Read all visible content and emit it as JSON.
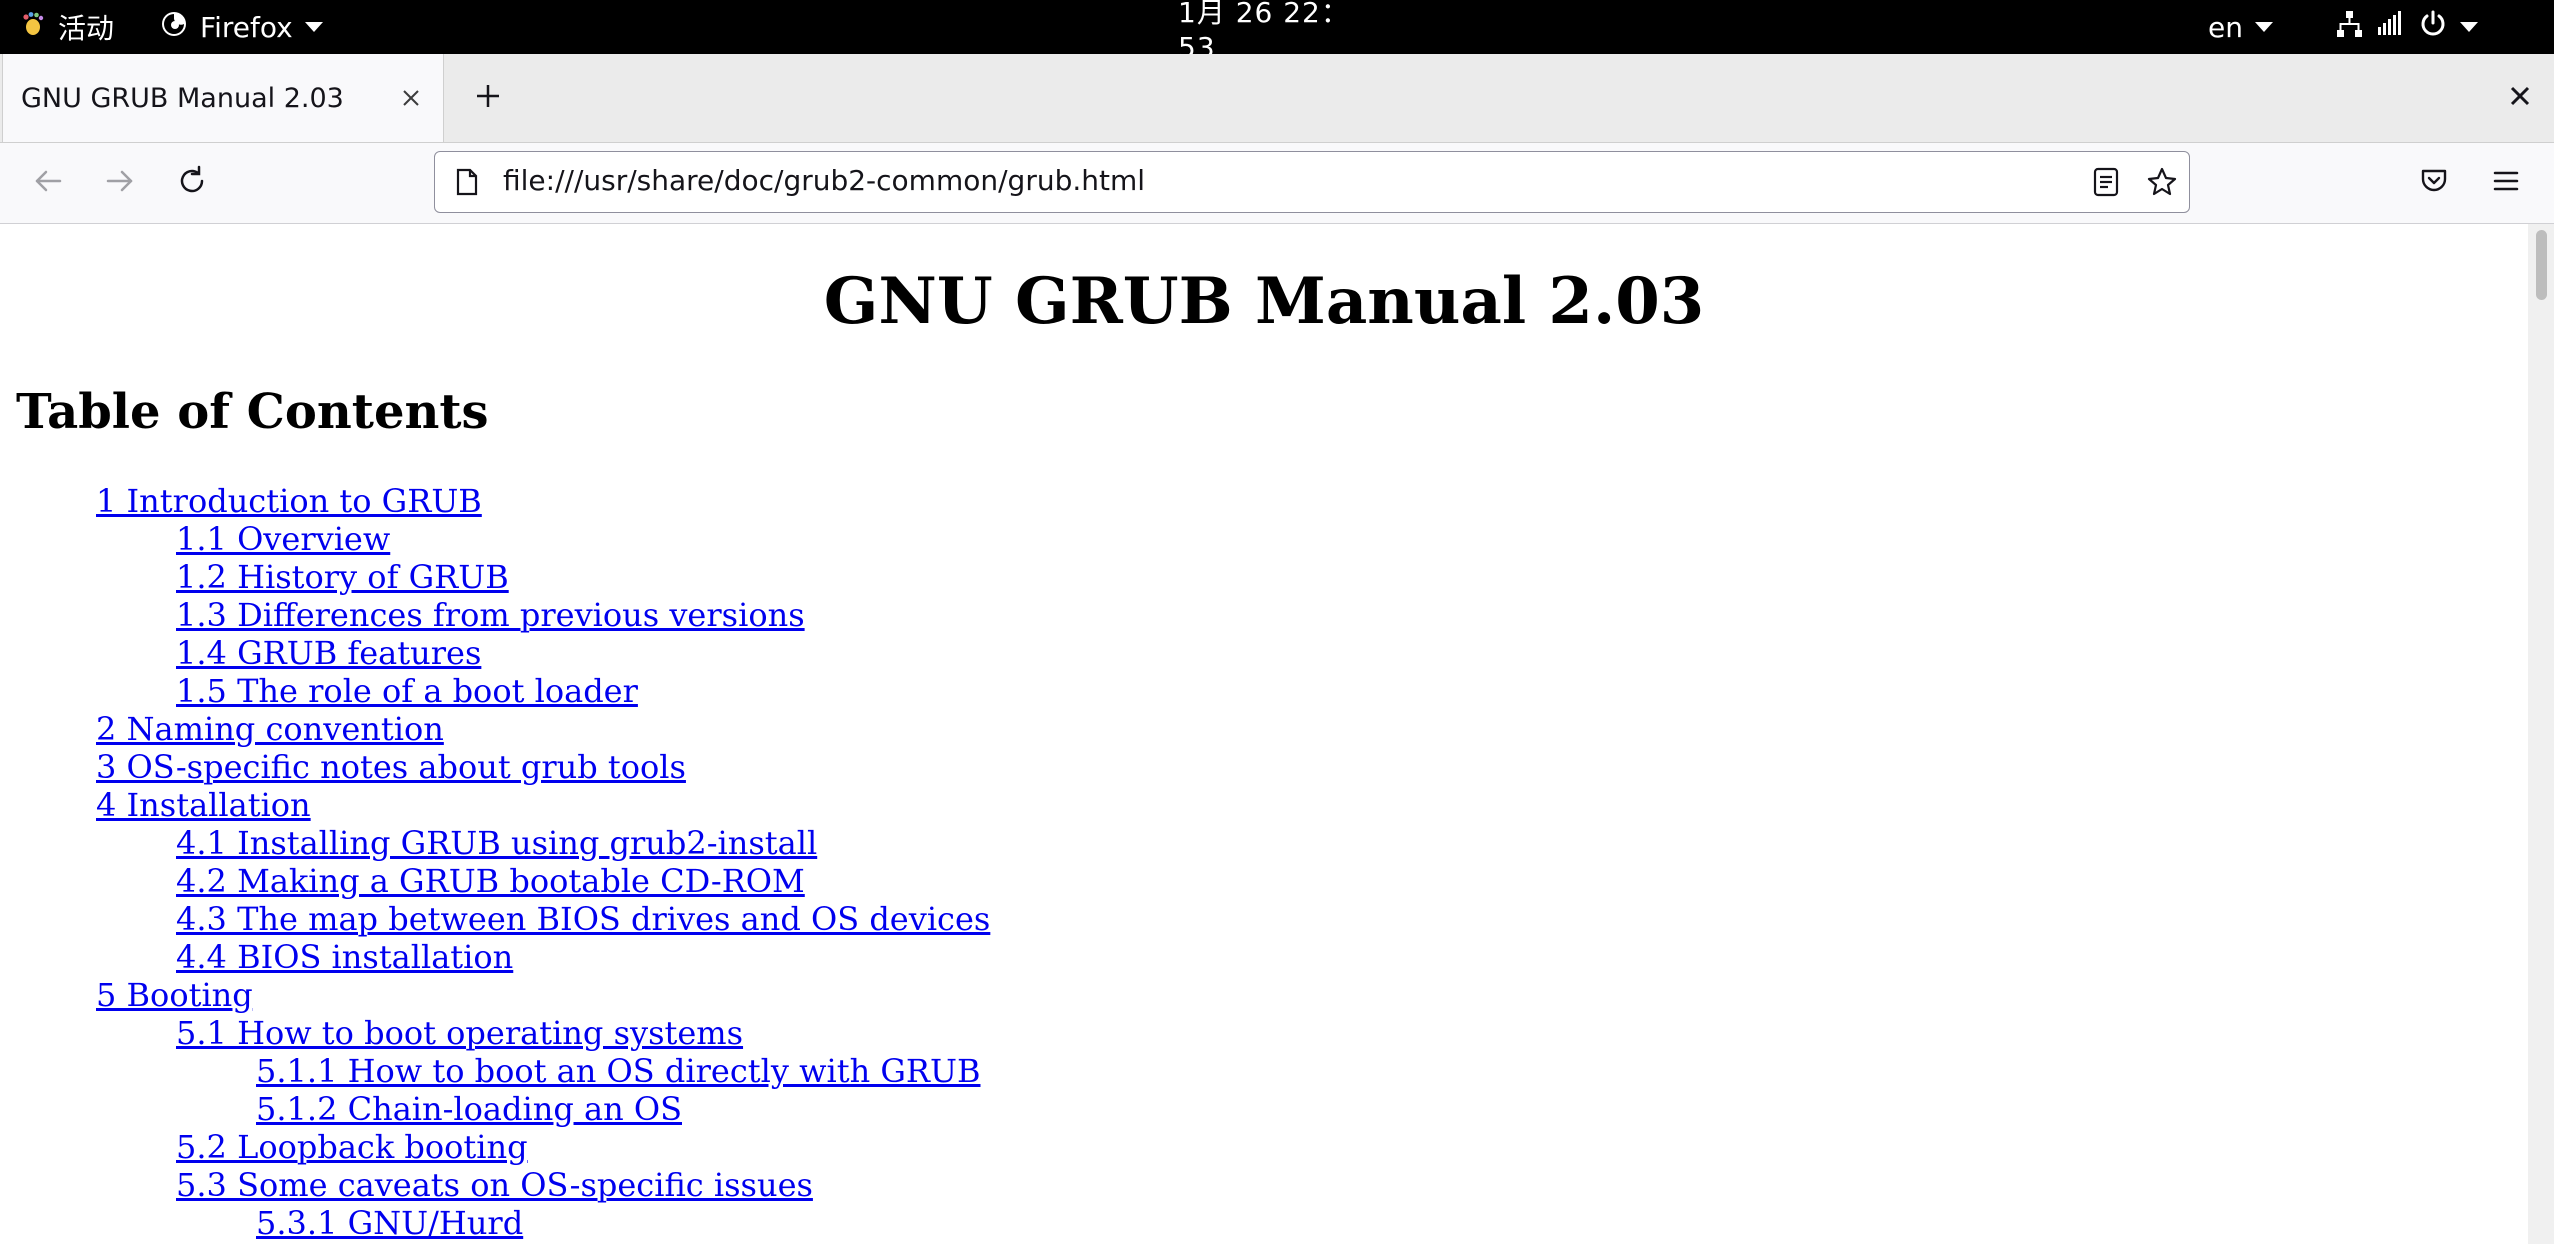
{
  "os_topbar": {
    "activities_label": "活动",
    "app_label": "Firefox",
    "clock": "1月 26  22：53",
    "input_lang": "en",
    "icons": [
      "network-icon",
      "volume-icon",
      "power-icon"
    ]
  },
  "browser": {
    "tab": {
      "title": "GNU GRUB Manual 2.03"
    },
    "url": "file:///usr/share/doc/grub2-common/grub.html",
    "icons": {
      "back": "back-arrow-icon",
      "forward": "forward-arrow-icon",
      "reload": "reload-icon",
      "page": "page-icon",
      "reader": "reader-view-icon",
      "bookmark": "star-icon",
      "pocket": "pocket-icon",
      "menu": "hamburger-menu-icon"
    }
  },
  "document": {
    "title": "GNU GRUB Manual 2.03",
    "toc_heading": "Table of Contents",
    "toc": [
      {
        "text": "1 Introduction to GRUB",
        "level": 1
      },
      {
        "text": "1.1 Overview",
        "level": 2
      },
      {
        "text": "1.2 History of GRUB",
        "level": 2
      },
      {
        "text": "1.3 Differences from previous versions",
        "level": 2
      },
      {
        "text": "1.4 GRUB features",
        "level": 2
      },
      {
        "text": "1.5 The role of a boot loader",
        "level": 2
      },
      {
        "text": "2 Naming convention",
        "level": 1
      },
      {
        "text": "3 OS-specific notes about grub tools",
        "level": 1
      },
      {
        "text": "4 Installation",
        "level": 1
      },
      {
        "text": "4.1 Installing GRUB using grub2-install",
        "level": 2
      },
      {
        "text": "4.2 Making a GRUB bootable CD-ROM",
        "level": 2
      },
      {
        "text": "4.3 The map between BIOS drives and OS devices",
        "level": 2
      },
      {
        "text": "4.4 BIOS installation",
        "level": 2
      },
      {
        "text": "5 Booting",
        "level": 1
      },
      {
        "text": "5.1 How to boot operating systems",
        "level": 2
      },
      {
        "text": "5.1.1 How to boot an OS directly with GRUB",
        "level": 3
      },
      {
        "text": "5.1.2 Chain-loading an OS",
        "level": 3
      },
      {
        "text": "5.2 Loopback booting",
        "level": 2
      },
      {
        "text": "5.3 Some caveats on OS-specific issues",
        "level": 2
      },
      {
        "text": "5.3.1 GNU/Hurd",
        "level": 3
      }
    ]
  },
  "colors": {
    "link": "#0000ee",
    "os_bar": "#000000",
    "tab_bar": "#ebebeb",
    "toolbar": "#f9f9fb"
  }
}
